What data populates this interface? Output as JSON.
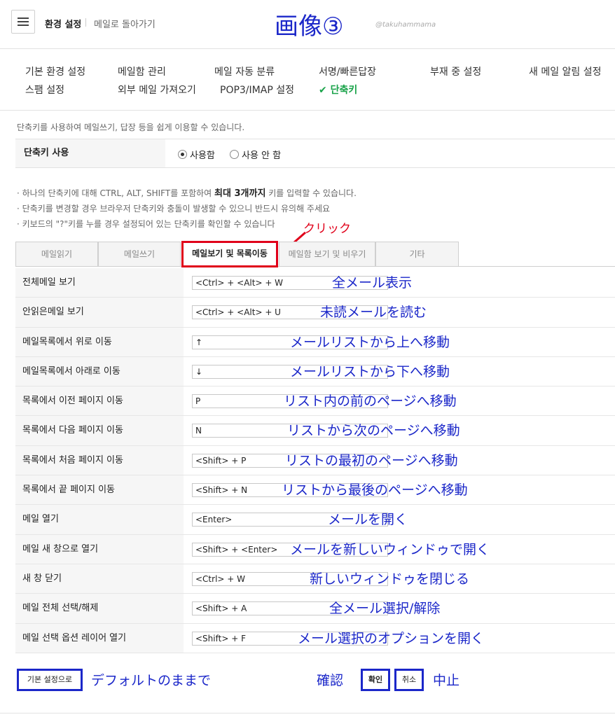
{
  "header": {
    "title": "환경 설정",
    "back": "메일로 돌아가기",
    "annotation_title": "画像③",
    "watermark": "@takuhammama"
  },
  "nav": [
    {
      "label": "기본 환경 설정"
    },
    {
      "label": "메일함 관리"
    },
    {
      "label": "메일 자동 분류"
    },
    {
      "label": "서명/빠른답장"
    },
    {
      "label": "부재 중 설정"
    },
    {
      "label": "새 메일 알림 설정"
    },
    {
      "label": "스팸 설정"
    },
    {
      "label": "외부 메일 가져오기"
    },
    {
      "label": "POP3/IMAP 설정"
    },
    {
      "label": "✔ 단축키"
    }
  ],
  "description": "단축키를 사용하여 메일쓰기, 답장 등을 쉽게 이용할 수 있습니다.",
  "use_shortcut": {
    "label": "단축키 사용",
    "on": "사용함",
    "off": "사용 안 함",
    "selected": "on"
  },
  "notes": {
    "n1_pre": "하나의 단축키에 대해 CTRL, ALT, SHIFT를 포함하여 ",
    "n1_bold": "최대 3개까지",
    "n1_post": " 키를 입력할 수 있습니다.",
    "n2": "단축키를 변경할 경우 브라우저 단축키와 충돌이 발생할 수 있으니 반드시 유의해 주세요",
    "n3": "키보드의 \"?\"키를 누를 경우 설정되어 있는 단축키를 확인할 수 있습니다"
  },
  "click_annotation": "クリック",
  "tabs": [
    {
      "label": "메일읽기"
    },
    {
      "label": "메일쓰기"
    },
    {
      "label": "메일보기 및 목록이동"
    },
    {
      "label": "메일함 보기 및 비우기"
    },
    {
      "label": "기타"
    }
  ],
  "rows": [
    {
      "label": "전체메일 보기",
      "key": "<Ctrl> + <Alt> + W",
      "ann": "全メール表示"
    },
    {
      "label": "안읽은메일 보기",
      "key": "<Ctrl> + <Alt> + U",
      "ann": "未読メールを読む"
    },
    {
      "label": "메일목록에서 위로 이동",
      "key": "↑",
      "ann": "メールリストから上へ移動"
    },
    {
      "label": "메일목록에서 아래로 이동",
      "key": "↓",
      "ann": "メールリストから下へ移動"
    },
    {
      "label": "목록에서 이전 페이지 이동",
      "key": "P",
      "ann": "リスト内の前のページへ移動"
    },
    {
      "label": "목록에서 다음 페이지 이동",
      "key": "N",
      "ann": "リストから次のページへ移動"
    },
    {
      "label": "목록에서 처음 페이지 이동",
      "key": "<Shift> + P",
      "ann": "リストの最初のページへ移動"
    },
    {
      "label": "목록에서 끝 페이지 이동",
      "key": "<Shift> + N",
      "ann": "リストから最後のページへ移動"
    },
    {
      "label": "메일 열기",
      "key": "<Enter>",
      "ann": "メールを開く"
    },
    {
      "label": "메일 새 창으로 열기",
      "key": "<Shift> + <Enter>",
      "ann": "メールを新しいウィンドゥで開く"
    },
    {
      "label": "새 창 닫기",
      "key": "<Ctrl> + W",
      "ann": "新しいウィンドゥを閉じる"
    },
    {
      "label": "메일 전체 선택/해제",
      "key": "<Shift> + A",
      "ann": "全メール選択/解除"
    },
    {
      "label": "메일 선택 옵션 레이어 열기",
      "key": "<Shift> + F",
      "ann": "メール選択のオプションを開く"
    }
  ],
  "footer": {
    "default_button": "기본 설정으로",
    "default_ann": "デフォルトのままで",
    "confirm_ann": "確認",
    "ok_button": "확인",
    "cancel_button": "취소",
    "cancel_ann": "中止"
  },
  "colors": {
    "annotation_blue": "#1b27c9",
    "annotation_red": "#e0001a",
    "active_green": "#1aa34a"
  }
}
